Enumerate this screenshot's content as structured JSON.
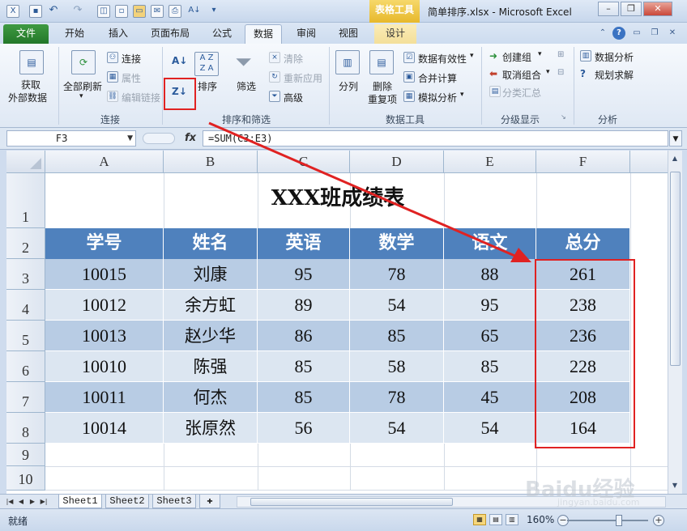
{
  "app": {
    "document_title": "简单排序.xlsx - Microsoft Excel",
    "context_tab_label": "表格工具"
  },
  "tabs": [
    {
      "label": "文件",
      "kind": "file"
    },
    {
      "label": "开始"
    },
    {
      "label": "插入"
    },
    {
      "label": "页面布局"
    },
    {
      "label": "公式"
    },
    {
      "label": "数据",
      "active": true
    },
    {
      "label": "审阅"
    },
    {
      "label": "视图"
    },
    {
      "label": "设计"
    }
  ],
  "ribbon": {
    "get_external": {
      "line1": "获取",
      "line2": "外部数据"
    },
    "connections": {
      "refresh_all": "全部刷新",
      "connections": "连接",
      "properties": "属性",
      "edit_links": "编辑链接",
      "group_label": "连接"
    },
    "sort_filter": {
      "sort": "排序",
      "filter": "筛选",
      "clear": "清除",
      "reapply": "重新应用",
      "advanced": "高级",
      "group_label": "排序和筛选"
    },
    "data_tools": {
      "text_to_columns": "分列",
      "remove_dup_1": "删除",
      "remove_dup_2": "重复项",
      "validation": "数据有效性",
      "consolidate": "合并计算",
      "what_if": "模拟分析",
      "group_label": "数据工具"
    },
    "outline": {
      "group": "创建组",
      "ungroup": "取消组合",
      "subtotal": "分类汇总",
      "group_label": "分级显示"
    },
    "analysis": {
      "data_analysis": "数据分析",
      "solver": "规划求解",
      "group_label": "分析"
    }
  },
  "formula_bar": {
    "name_box": "F3",
    "fx": "fx",
    "formula": "=SUM(C3:E3)"
  },
  "grid": {
    "columns": [
      "A",
      "B",
      "C",
      "D",
      "E",
      "F"
    ],
    "rows": [
      "1",
      "2",
      "3",
      "4",
      "5",
      "6",
      "7",
      "8",
      "9",
      "10"
    ],
    "title": "XXX班成绩表",
    "headers": [
      "学号",
      "姓名",
      "英语",
      "数学",
      "语文",
      "总分"
    ],
    "records": [
      [
        "10015",
        "刘康",
        "95",
        "78",
        "88",
        "261"
      ],
      [
        "10012",
        "余方虹",
        "89",
        "54",
        "95",
        "238"
      ],
      [
        "10013",
        "赵少华",
        "86",
        "85",
        "65",
        "236"
      ],
      [
        "10010",
        "陈强",
        "85",
        "58",
        "85",
        "228"
      ],
      [
        "10011",
        "何杰",
        "85",
        "78",
        "45",
        "208"
      ],
      [
        "10014",
        "张原然",
        "56",
        "54",
        "54",
        "164"
      ]
    ]
  },
  "sheets": [
    "Sheet1",
    "Sheet2",
    "Sheet3"
  ],
  "status": {
    "ready": "就绪",
    "zoom": "160%"
  },
  "watermark": {
    "logo": "Baidu经验",
    "url": "jingyan.baidu.com"
  },
  "colors": {
    "header_fill": "#4f81bd",
    "band_dark": "#b8cce4",
    "band_light": "#dce6f1",
    "annotation_red": "#e02222",
    "file_tab": "#2e8b32"
  },
  "icons": [
    "save-icon",
    "undo-icon",
    "redo-icon",
    "sort-az-icon",
    "sort-za-icon",
    "sort-icon",
    "filter-icon",
    "help-icon"
  ]
}
